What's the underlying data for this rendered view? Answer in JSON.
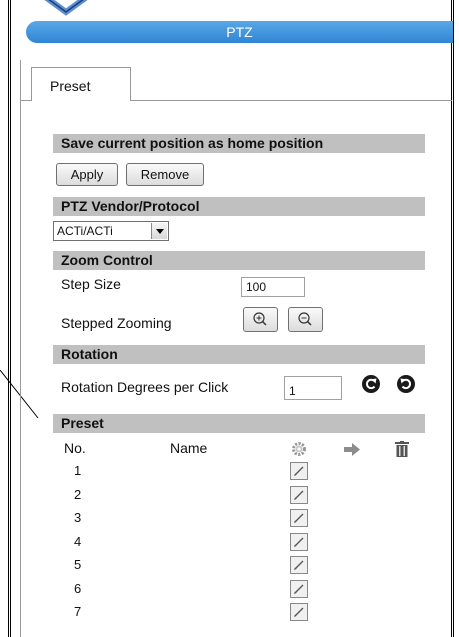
{
  "title": "PTZ",
  "tab": {
    "label": "Preset"
  },
  "home": {
    "heading": "Save current position as home position",
    "apply": "Apply",
    "remove": "Remove"
  },
  "vendor": {
    "heading": "PTZ Vendor/Protocol",
    "selected": "ACTi/ACTi"
  },
  "zoom": {
    "heading": "Zoom Control",
    "step_label": "Step Size",
    "step_value": "100",
    "stepped_label": "Stepped Zooming"
  },
  "rotation": {
    "heading": "Rotation",
    "degrees_label": "Rotation Degrees per Click",
    "degrees_value": "1"
  },
  "preset": {
    "heading": "Preset",
    "col_no": "No.",
    "col_name": "Name",
    "rows": [
      "1",
      "2",
      "3",
      "4",
      "5",
      "6",
      "7"
    ]
  },
  "icons": {
    "zoom_in": "zoom-in-icon",
    "zoom_out": "zoom-out-icon",
    "rotate_ccw": "rotate-left-icon",
    "rotate_cw": "rotate-right-icon",
    "settings": "gear-icon",
    "goto": "arrow-right-icon",
    "delete": "trash-icon",
    "edit": "pencil-icon"
  }
}
